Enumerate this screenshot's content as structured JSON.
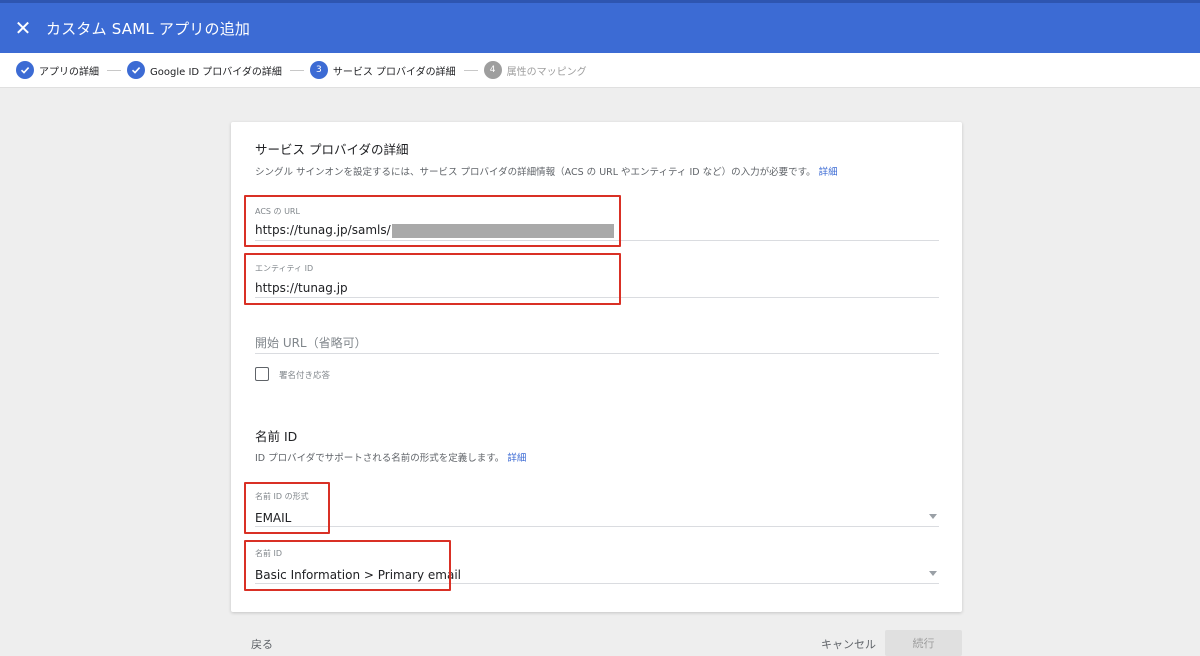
{
  "header": {
    "close_icon": "close-icon",
    "title": "カスタム SAML アプリの追加",
    "background_color": "#3c6bd4"
  },
  "stepper": {
    "steps": [
      {
        "label": "アプリの詳細",
        "state": "done",
        "icon": "check-icon"
      },
      {
        "label": "Google ID プロバイダの詳細",
        "state": "done",
        "icon": "check-icon"
      },
      {
        "label": "サービス プロバイダの詳細",
        "state": "current",
        "number": "3"
      },
      {
        "label": "属性のマッピング",
        "state": "upcoming",
        "number": "4"
      }
    ]
  },
  "service_provider": {
    "title": "サービス プロバイダの詳細",
    "description": "シングル サインオンを設定するには、サービス プロバイダの詳細情報（ACS の URL やエンティティ ID など）の入力が必要です。",
    "details_link": "詳細",
    "acs_url": {
      "label": "ACS の URL",
      "value": "https://tunag.jp/samls/"
    },
    "entity_id": {
      "label": "エンティティ ID",
      "value": "https://tunag.jp"
    },
    "start_url": {
      "placeholder": "開始 URL（省略可）",
      "value": ""
    },
    "signed_response": {
      "label": "署名付き応答",
      "checked": false
    }
  },
  "name_id": {
    "title": "名前 ID",
    "description": "ID プロバイダでサポートされる名前の形式を定義します。",
    "details_link": "詳細",
    "format": {
      "label": "名前 ID の形式",
      "value": "EMAIL"
    },
    "name_id_field": {
      "label": "名前 ID",
      "value": "Basic Information > Primary email"
    }
  },
  "footer": {
    "back_label": "戻る",
    "cancel_label": "キャンセル",
    "continue_label": "続行"
  },
  "colors": {
    "accent": "#3c6bd4",
    "highlight": "#d93025"
  }
}
